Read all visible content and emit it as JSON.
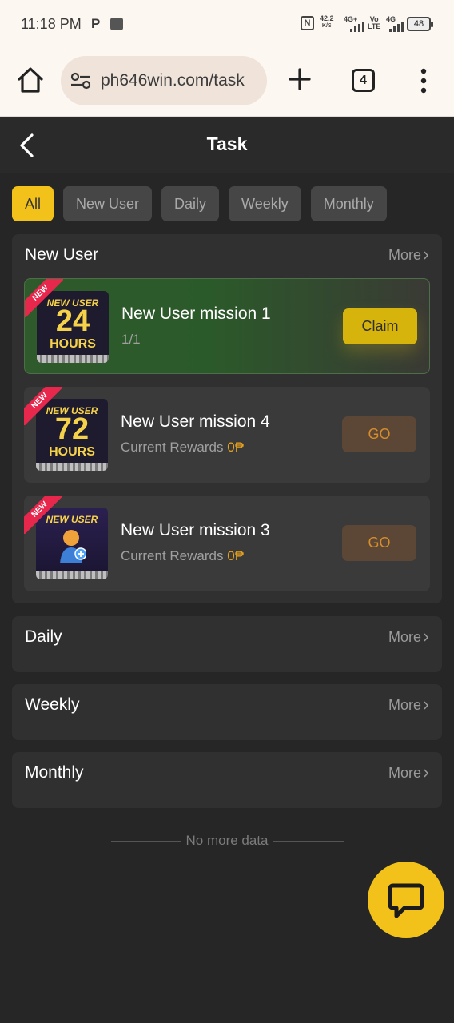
{
  "status_bar": {
    "time": "11:18 PM",
    "p_label": "P",
    "nfc": "N",
    "speed_value": "42.2",
    "speed_unit": "K/S",
    "net1": "4G+",
    "net2_top": "Vo",
    "net2_bottom": "LTE",
    "net3": "4G",
    "battery": "48"
  },
  "browser": {
    "url": "ph646win.com/task",
    "tab_count": "4"
  },
  "header": {
    "title": "Task"
  },
  "filters": [
    {
      "label": "All",
      "active": true
    },
    {
      "label": "New User",
      "active": false
    },
    {
      "label": "Daily",
      "active": false
    },
    {
      "label": "Weekly",
      "active": false
    },
    {
      "label": "Monthly",
      "active": false
    }
  ],
  "sections": {
    "new_user": {
      "title": "New User",
      "more": "More",
      "missions": [
        {
          "badge": "NEW",
          "thumb_line1": "NEW USER",
          "thumb_line2": "24",
          "thumb_line3": "HOURS",
          "title": "New User mission 1",
          "subtitle": "1/1",
          "action": "Claim"
        },
        {
          "badge": "NEW",
          "thumb_line1": "NEW USER",
          "thumb_line2": "72",
          "thumb_line3": "HOURS",
          "title": "New User mission 4",
          "subtitle": "Current Rewards",
          "reward": "0",
          "currency": "₱",
          "action": "GO"
        },
        {
          "badge": "NEW",
          "thumb_line1": "NEW USER",
          "title": "New User mission 3",
          "subtitle": "Current Rewards",
          "reward": "0",
          "currency": "₱",
          "action": "GO"
        }
      ]
    },
    "daily": {
      "title": "Daily",
      "more": "More"
    },
    "weekly": {
      "title": "Weekly",
      "more": "More"
    },
    "monthly": {
      "title": "Monthly",
      "more": "More"
    }
  },
  "footer": {
    "no_more": "No more data"
  },
  "colors": {
    "accent": "#f2c21a",
    "background": "#262626",
    "card": "#303030",
    "go_text": "#d68d2c",
    "badge": "#e8274d"
  }
}
